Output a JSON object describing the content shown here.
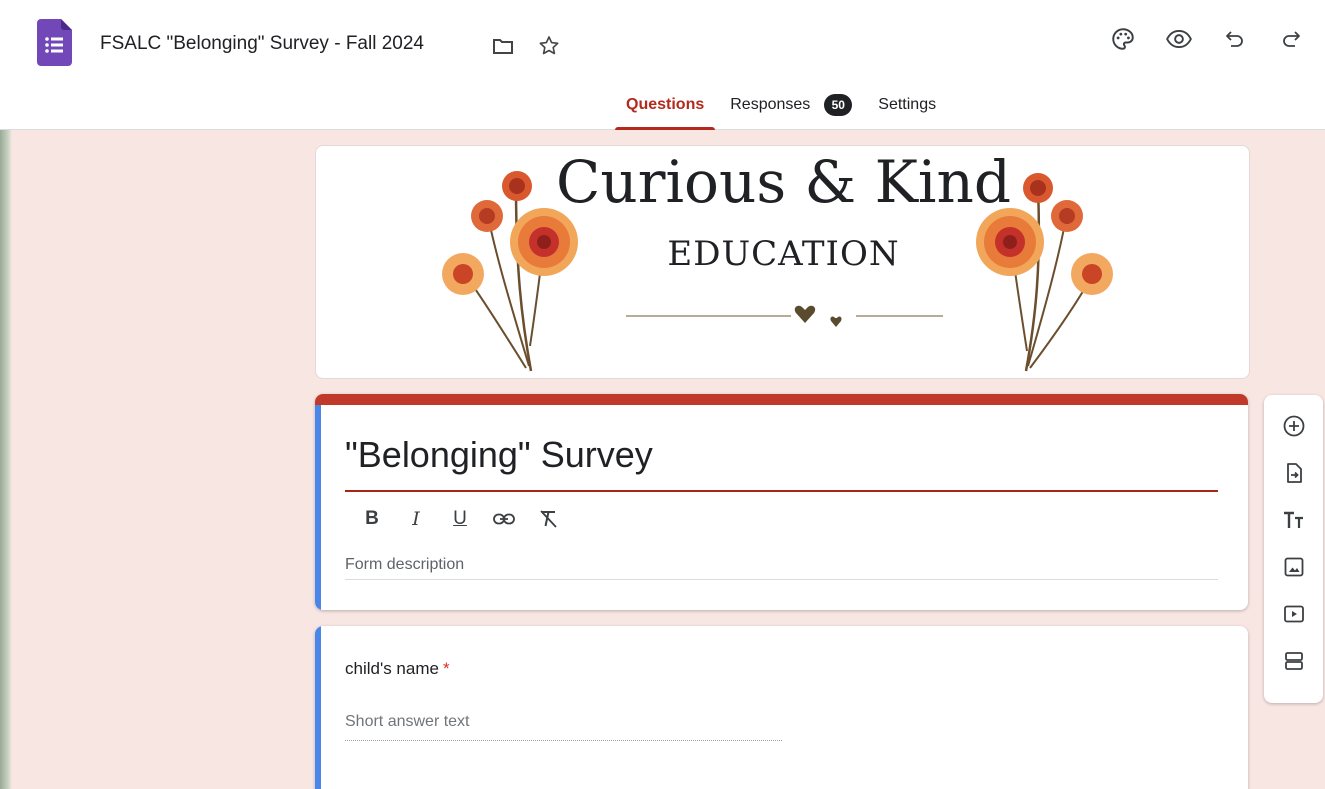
{
  "header": {
    "title": "FSALC \"Belonging\" Survey - Fall 2024",
    "icons": [
      "forms-app-icon",
      "folder-icon",
      "star-icon",
      "palette-icon",
      "eye-icon",
      "undo-icon",
      "redo-icon"
    ]
  },
  "tabs": [
    {
      "label": "Questions",
      "active": true
    },
    {
      "label": "Responses",
      "badge": "50"
    },
    {
      "label": "Settings"
    }
  ],
  "banner": {
    "title": "Curious & Kind",
    "subtitle": "EDUCATION"
  },
  "form": {
    "title": "\"Belonging\" Survey",
    "format_tools": [
      "bold-icon",
      "italic-icon",
      "underline-icon",
      "link-icon",
      "clear-format-icon"
    ],
    "description_placeholder": "Form description"
  },
  "question": {
    "title": "child's name",
    "required_mark": "*",
    "answer_placeholder": "Short answer text"
  },
  "side_toolbar": [
    "add-question-icon",
    "import-questions-icon",
    "add-title-icon",
    "add-image-icon",
    "add-video-icon",
    "add-section-icon"
  ],
  "colors": {
    "accent": "#b32a1c",
    "header_bar": "#c0392b",
    "focus_bar": "#4a86e8",
    "background": "#f8e6e3",
    "forms_purple": "#7248b9"
  }
}
